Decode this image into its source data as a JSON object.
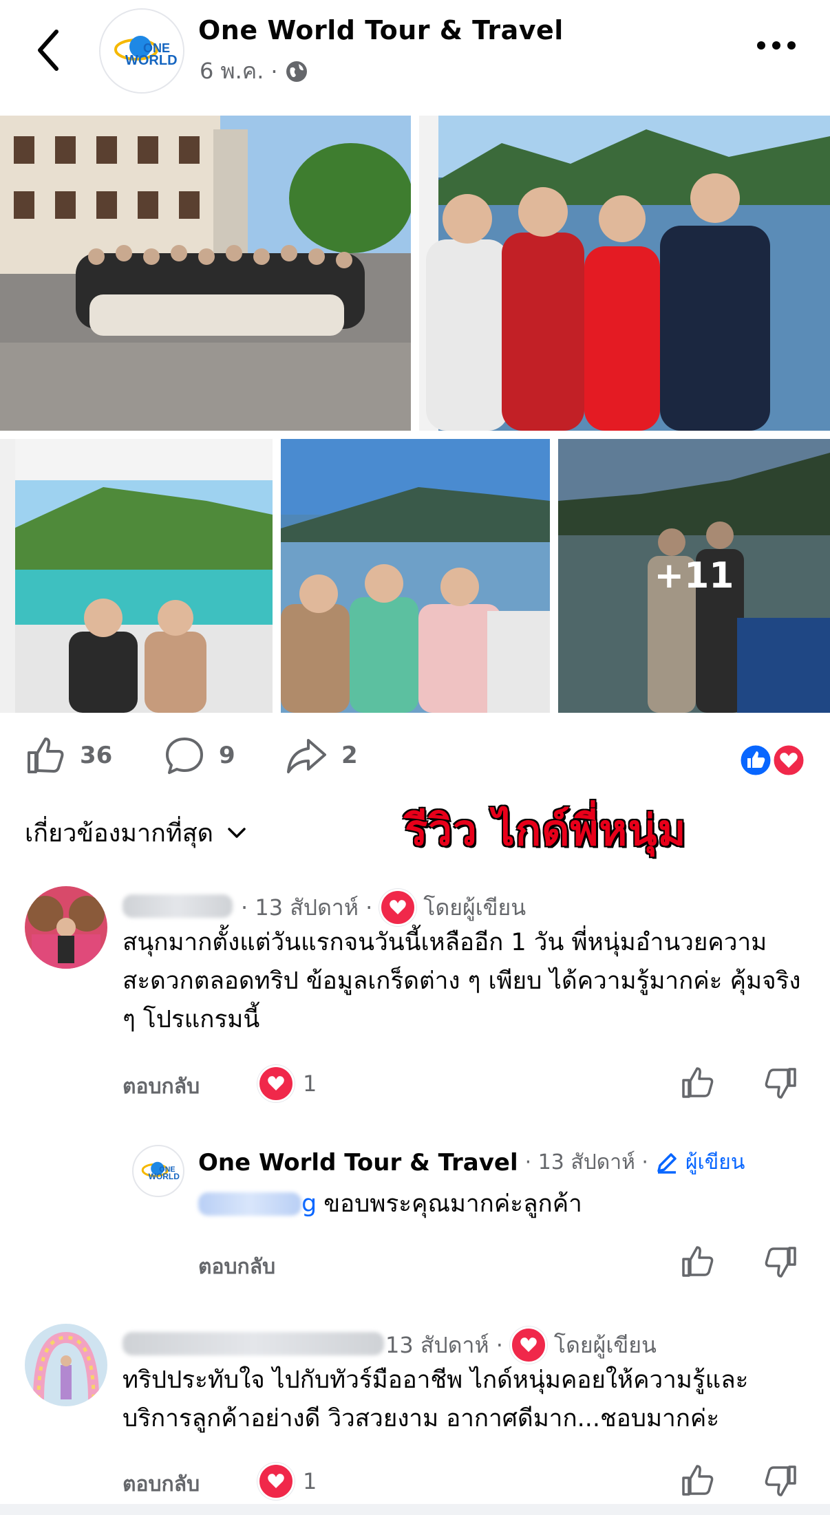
{
  "header": {
    "page_name": "One World Tour & Travel",
    "date": "6 พ.ค.",
    "separator": "·"
  },
  "photos": {
    "more_count": "+11"
  },
  "actions": {
    "like_count": "36",
    "comment_count": "9",
    "share_count": "2"
  },
  "sort": {
    "label": "เกี่ยวข้องมากที่สุด"
  },
  "overlay": {
    "review_title": "รีวิว ไกด์พี่หนุ่ม"
  },
  "comments": [
    {
      "time": "· 13 สัปดาห์ ·",
      "author_badge": "โดยผู้เขียน",
      "text": "สนุกมากตั้งแต่วันแรกจนวันนี้เหลืออีก 1 วัน พี่หนุ่มอำนวยความสะดวกตลอดทริป ข้อมูลเกร็ดต่าง ๆ เพียบ ได้ความรู้มากค่ะ คุ้มจริง ๆ โปรแกรมนี้",
      "reply_label": "ตอบกลับ",
      "reaction_count": "1"
    },
    {
      "time": "13 สัปดาห์ ·",
      "author_badge": "โดยผู้เขียน",
      "text": "ทริปประทับใจ ไปกับทัวร์มืออาชีพ ไกด์หนุ่มคอยให้ความรู้และบริการลูกค้าอย่างดี วิวสวยงาม อากาศดีมาก...ชอบมากค่ะ",
      "reply_label": "ตอบกลับ",
      "reaction_count": "1"
    }
  ],
  "reply": {
    "author": "One World Tour & Travel",
    "time": "· 13 สัปดาห์ ·",
    "badge": "ผู้เขียน",
    "mention_suffix": "g",
    "text": "ขอบพระคุณมากค่ะลูกค้า",
    "reply_label": "ตอบกลับ"
  },
  "colors": {
    "like_blue": "#0866ff",
    "love_red": "#f0284a",
    "review_red": "#e8001a"
  }
}
